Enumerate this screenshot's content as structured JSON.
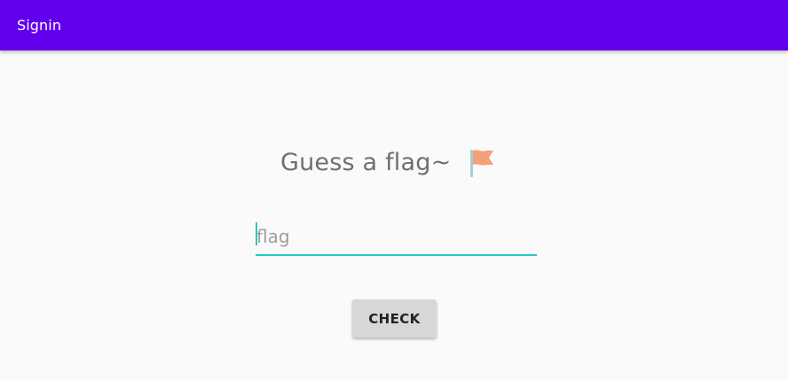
{
  "app_bar": {
    "title": "Signin",
    "background_color": "#6200ee",
    "text_color": "#ffffff"
  },
  "main": {
    "headline": "Guess a flag~",
    "headline_icon": "flag-icon",
    "input": {
      "value": "",
      "placeholder": "flag",
      "accent_color": "#26c7c2"
    },
    "check_button": {
      "label": "CHECK",
      "background_color": "#d6d7d7"
    }
  },
  "colors": {
    "page_background": "#fafafa",
    "headline_text": "#6f6f6f",
    "flag_pole": "#9fd3cf",
    "flag_cloth": "#f6a07b"
  }
}
